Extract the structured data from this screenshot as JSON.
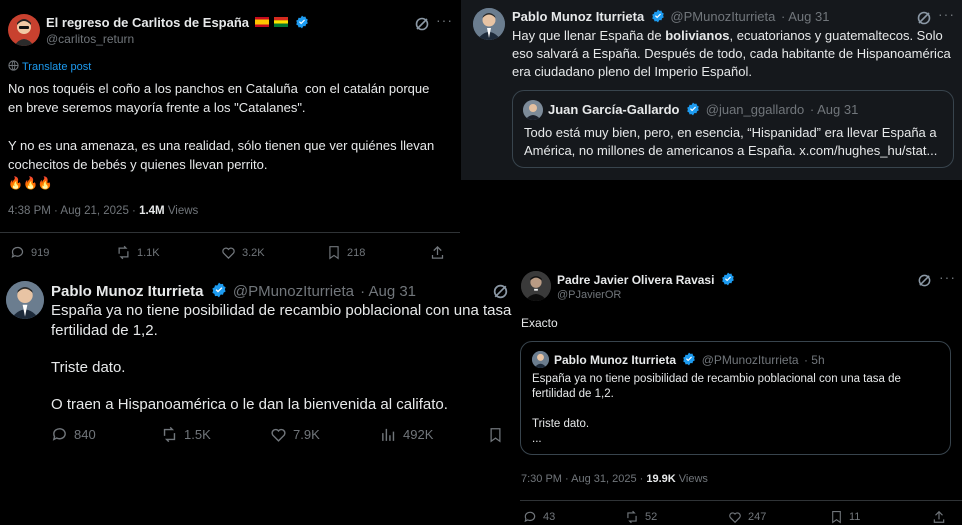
{
  "colors": {
    "accent": "#1d9bf0",
    "text": "#e7e9ea",
    "muted": "#71767b",
    "background": "#000000"
  },
  "tweet1": {
    "name": "El regreso de Carlitos de España",
    "handle": "@carlitos_return",
    "translate": "Translate post",
    "text": [
      "No nos toquéis el coño a los panchos en Cataluña  con el catalán porque",
      "en breve seremos mayoría frente a los \"Catalanes\".",
      "",
      "Y no es una amenaza, es una realidad, sólo tienen que ver quiénes llevan",
      "cochecitos de bebés y quienes llevan perrito."
    ],
    "emoji": "🔥🔥🔥",
    "time": "4:38 PM · Aug 21, 2025 · ",
    "views_count": "1.4M",
    "views_label": " Views",
    "replies": "919",
    "reposts": "1.1K",
    "likes": "3.2K",
    "bookmarks": "218"
  },
  "tweet2": {
    "name": "Pablo Munoz Iturrieta",
    "handle": "@PMunozIturrieta",
    "date": "· Aug 31",
    "line1_pre": "Hay que llenar España de ",
    "line1_bold": "bolivianos",
    "line1_post": ", ecuatorianos y guatemaltecos. Solo",
    "line2": "eso salvará a España. Después de todo, cada habitante de Hispanoamérica",
    "line3": "era ciudadano pleno del Imperio Español.",
    "quote": {
      "name": "Juan García-Gallardo",
      "handle": "@juan_ggallardo",
      "date": "· Aug 31",
      "line1": "Todo está muy bien, pero, en esencia, “Hispanidad” era llevar España a",
      "line2": "América, no millones de americanos a España. x.com/hughes_hu/stat..."
    }
  },
  "tweet3": {
    "name": "Pablo Munoz Iturrieta",
    "handle": "@PMunozIturrieta",
    "date": "· Aug 31",
    "text": [
      "España ya no tiene posibilidad de recambio poblacional con una tasa de",
      "fertilidad de 1,2.",
      "",
      "Triste dato.",
      "",
      "O traen a Hispanoamérica o le dan la bienvenida al califato."
    ],
    "replies": "840",
    "reposts": "1.5K",
    "likes": "7.9K",
    "views": "492K"
  },
  "tweet4": {
    "name": "Padre Javier Olivera Ravasi",
    "handle": "@PJavierOR",
    "text": "Exacto",
    "quote": {
      "name": "Pablo Munoz Iturrieta",
      "handle": "@PMunozIturrieta",
      "date": "· 5h",
      "text": [
        "España ya no tiene posibilidad de recambio poblacional con una tasa de",
        "fertilidad de 1,2.",
        "",
        "Triste dato.",
        "..."
      ]
    },
    "time": "7:30 PM · Aug 31, 2025 · ",
    "views_count": "19.9K",
    "views_label": " Views",
    "replies": "43",
    "reposts": "52",
    "likes": "247",
    "bookmarks": "11"
  }
}
